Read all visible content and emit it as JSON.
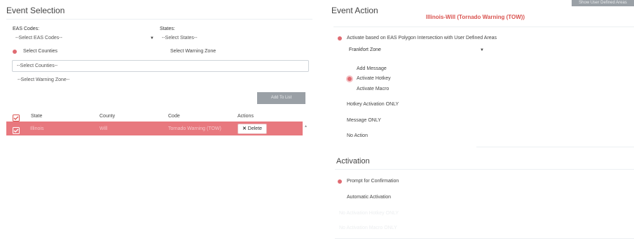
{
  "top_button": "Show User Defined Areas",
  "event_selection": {
    "title": "Event Selection",
    "eas_label": "EAS Codes:",
    "eas_placeholder": "--Select EAS Codes--",
    "states_label": "States:",
    "states_placeholder": "--Select States--",
    "radio_counties": "Select Counties",
    "radio_warning_zone": "Select Warning Zone",
    "counties_placeholder": "--Select Counties--",
    "warning_zone_placeholder": "--Select Warning Zone--",
    "add_button": "Add To List"
  },
  "table": {
    "headers": [
      "State",
      "County",
      "Code",
      "Actions"
    ],
    "rows": [
      {
        "state": "Illinois",
        "county": "Will",
        "code": "Tornado Warning (TOW)",
        "action": "Delete"
      }
    ]
  },
  "event_action": {
    "title": "Event Action",
    "alert_title": "Illinois-Will (Tornado Warning (TOW))",
    "option_polygon": "Activate based on EAS Polygon Intersection with User Defined Areas",
    "zone_select": "Frankfort Zone",
    "sub_add_message": "Add Message",
    "sub_activate_hotkey": "Activate Hotkey",
    "sub_activate_macro": "Activate Macro",
    "option_hotkey_only": "Hotkey Activation ONLY",
    "option_message_only": "Message ONLY",
    "option_no_action": "No Action"
  },
  "activation": {
    "title": "Activation",
    "prompt": "Prompt for Confirmation",
    "automatic": "Automatic Activation",
    "faint_1": "No Activation Hotkey ONLY",
    "faint_2": "No Activation Macro ONLY"
  },
  "colors": {
    "accent": "#e06b72",
    "alert": "#d9534f"
  }
}
